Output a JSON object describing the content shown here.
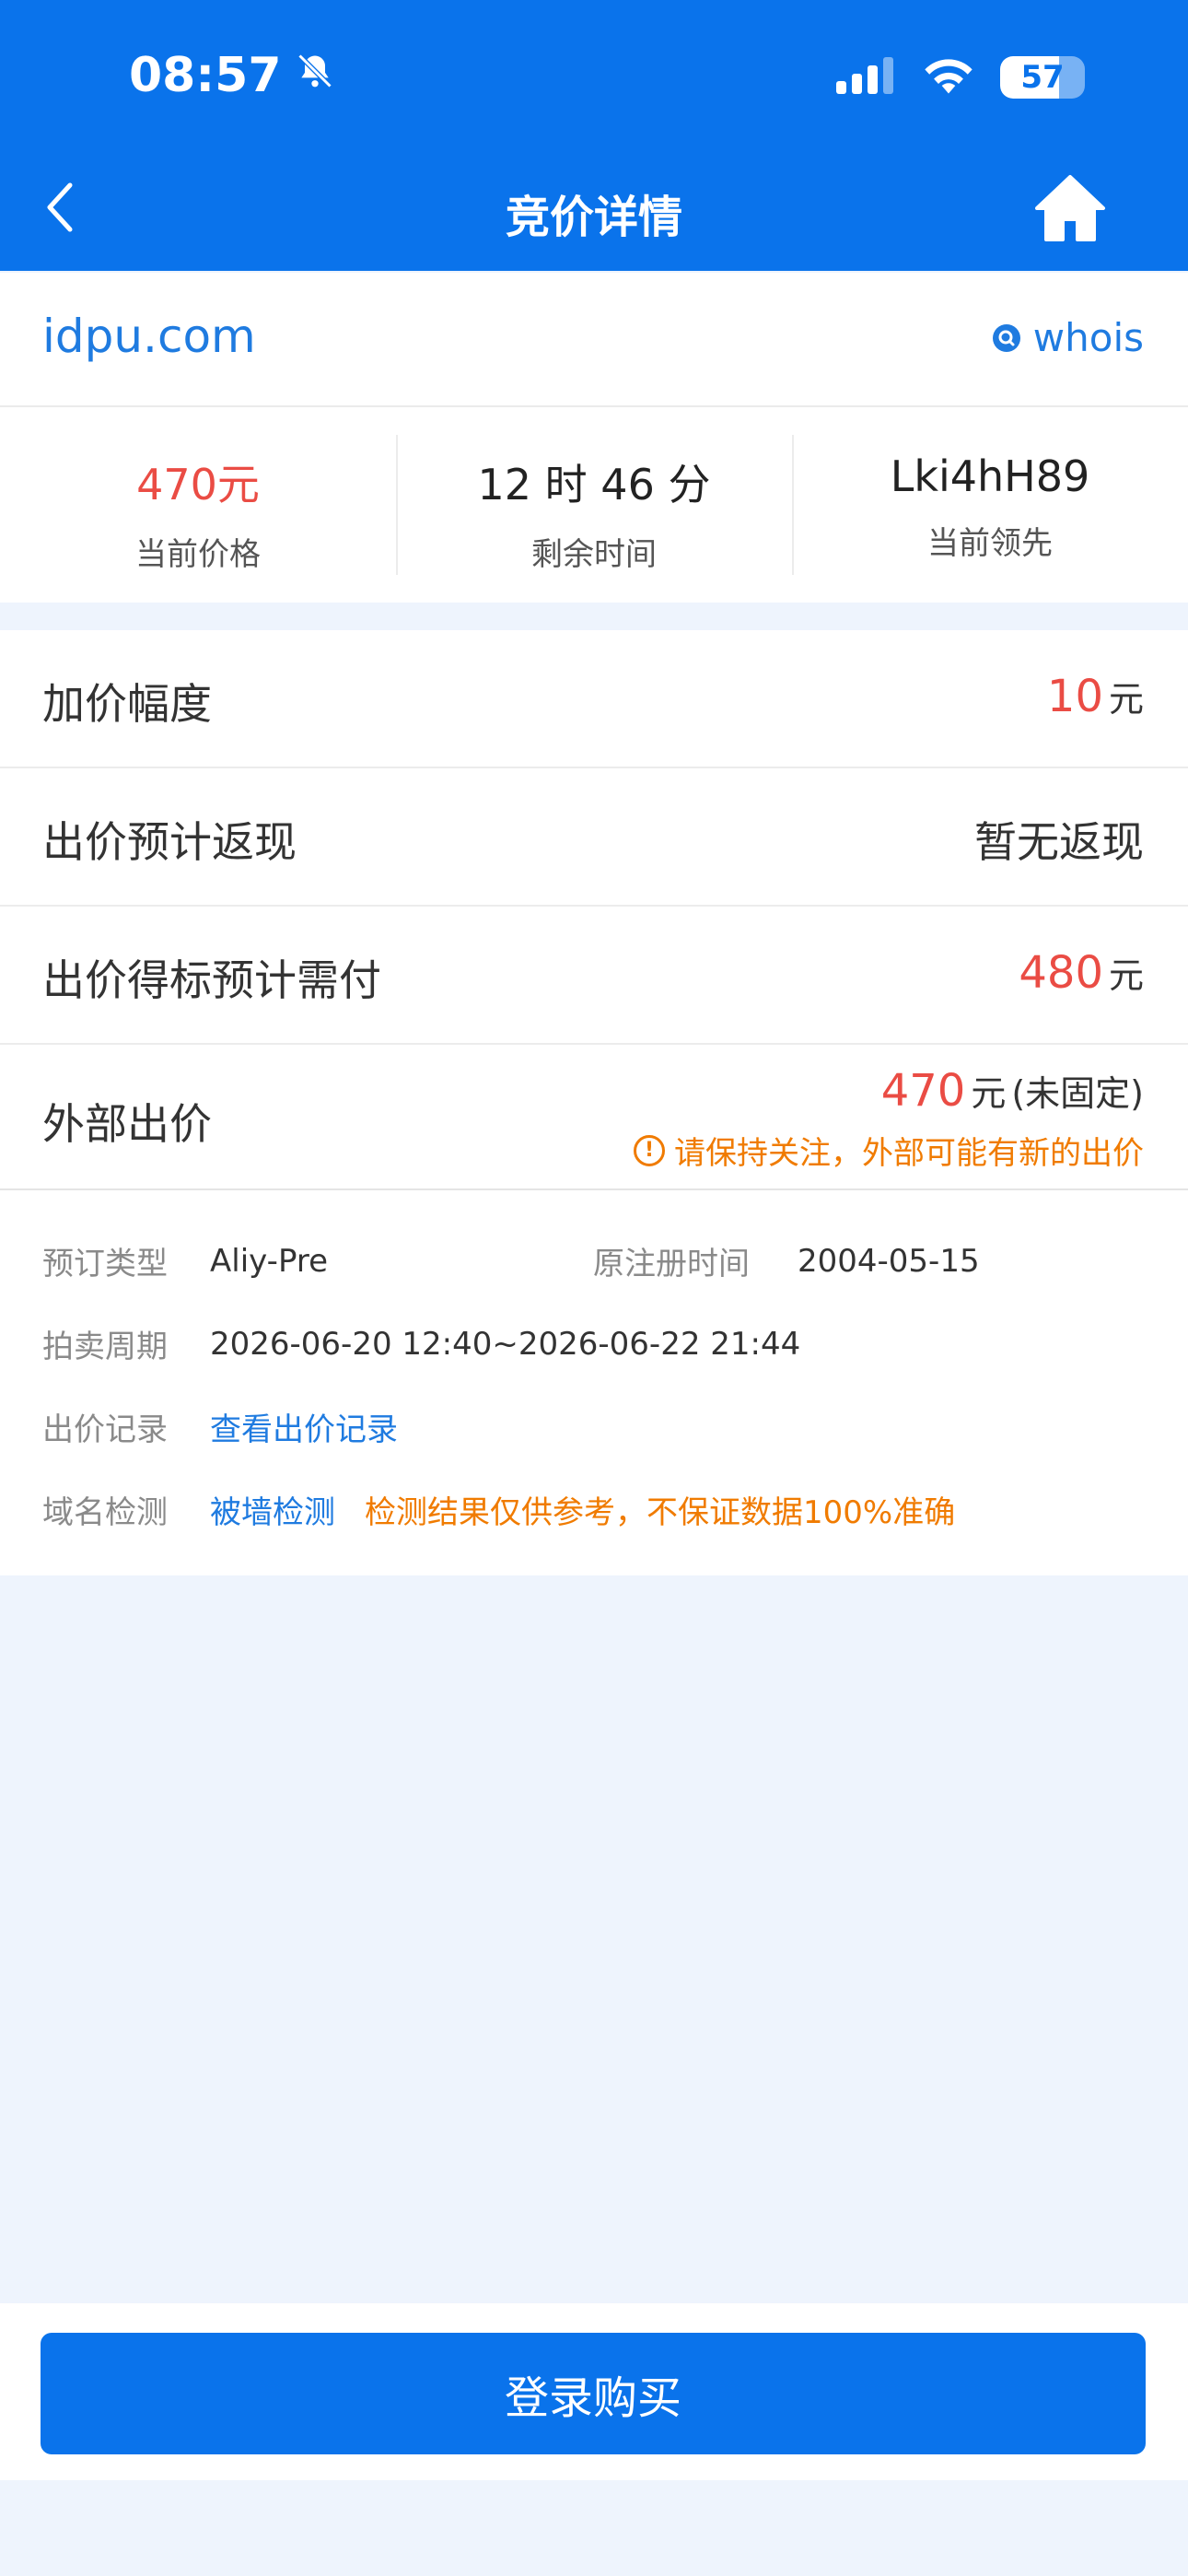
{
  "status_bar": {
    "time": "08:57",
    "battery": "57"
  },
  "nav": {
    "title": "竞价详情"
  },
  "domain": {
    "name": "idpu.com",
    "whois_label": "whois"
  },
  "stats": [
    {
      "value": "470元",
      "label": "当前价格"
    },
    {
      "value": "12 时 46 分",
      "label": "剩余时间"
    },
    {
      "value": "Lki4hH89",
      "label": "当前领先"
    }
  ],
  "rows": {
    "increment": {
      "label": "加价幅度",
      "value": "10",
      "unit": "元"
    },
    "cashback": {
      "label": "出价预计返现",
      "value": "暂无返现"
    },
    "payment": {
      "label": "出价得标预计需付",
      "value": "480",
      "unit": "元"
    },
    "external": {
      "label": "外部出价",
      "value": "470",
      "unit": "元",
      "suffix": "(未固定)",
      "note": "请保持关注，外部可能有新的出价"
    }
  },
  "info": {
    "type_label": "预订类型",
    "type_value": "Aliy-Pre",
    "reg_label": "原注册时间",
    "reg_value": "2004-05-15",
    "period_label": "拍卖周期",
    "period_value": "2026-06-20 12:40~2026-06-22 21:44",
    "record_label": "出价记录",
    "record_link": "查看出价记录",
    "check_label": "域名检测",
    "check_link": "被墙检测",
    "check_note": "检测结果仅供参考，不保证数据100%准确"
  },
  "bottom": {
    "button_label": "登录购买"
  },
  "colors": {
    "primary": "#0a73eb",
    "price_red": "#ea4c44",
    "warning_orange": "#f07b00",
    "background": "#eef4fd"
  }
}
